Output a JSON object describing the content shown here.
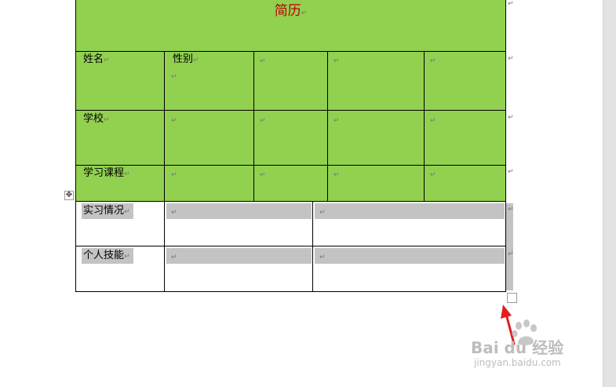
{
  "document": {
    "title": "简历",
    "mark": "↵",
    "rows": {
      "name_label": "姓名",
      "gender_label": "性别",
      "school_label": "学校",
      "courses_label": "学习课程",
      "internship_label": "实习情况",
      "skills_label": "个人技能"
    }
  },
  "watermark": {
    "brand": "Bai du 经验",
    "url": "jingyan.baidu.com"
  },
  "colors": {
    "table_fill": "#92d050",
    "title_text": "#c00000",
    "selection_shade": "#c3c3c3",
    "arrow": "#e02020"
  },
  "icons": {
    "move_handle": "four-arrow-move-icon",
    "resize_handle": "table-resize-handle-icon",
    "arrow": "red-arrow-pointer"
  }
}
